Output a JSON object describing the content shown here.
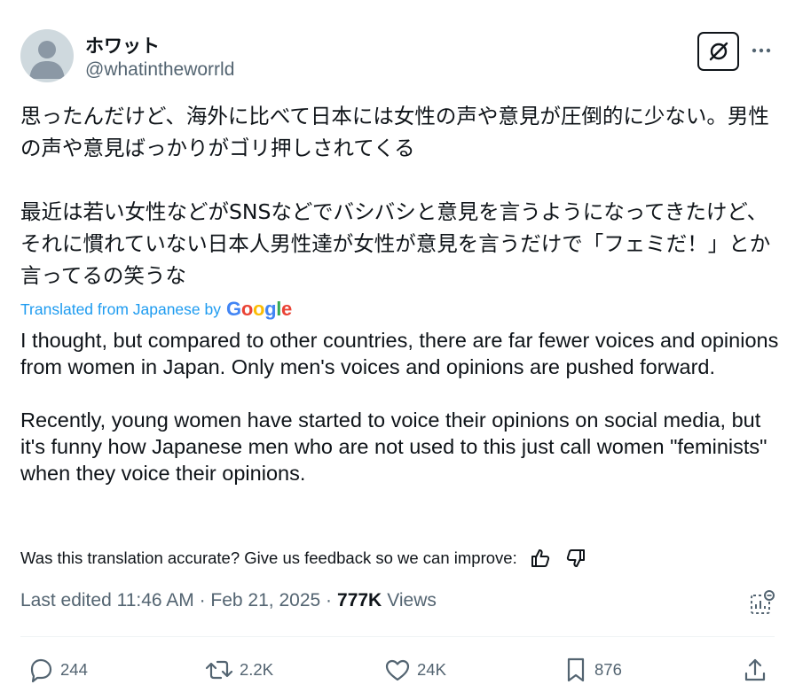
{
  "author": {
    "display_name": "ホワット",
    "handle": "@whatintheworrld"
  },
  "post": {
    "text_jp": "思ったんだけど、海外に比べて日本には女性の声や意見が圧倒的に少ない。男性の声や意見ばっかりがゴリ押しされてくる\n\n最近は若い女性などがSNSなどでバシバシと意見を言うようになってきたけど、それに慣れていない日本人男性達が女性が意見を言うだけで「フェミだ！」とか言ってるの笑うな",
    "translated_label": "Translated from Japanese by",
    "google_logo": {
      "g1": "G",
      "o1": "o",
      "o2": "o",
      "g2": "g",
      "l": "l",
      "e": "e"
    },
    "text_en": "I thought, but compared to other countries, there are far fewer voices and opinions from women in Japan. Only men's voices and opinions are pushed forward.\n\nRecently, young women have started to voice their opinions on social media, but it's funny how Japanese men who are not used to this just call women \"feminists\" when they voice their opinions.",
    "feedback_prompt": "Was this translation accurate? Give us feedback so we can improve:",
    "meta": {
      "edited": "Last edited 11:46 AM · Feb 21, 2025 ·",
      "views_count": "777K",
      "views_label": "Views"
    }
  },
  "actions": {
    "replies": "244",
    "reposts": "2.2K",
    "likes": "24K",
    "bookmarks": "876"
  },
  "icons": [
    "grok-icon",
    "more-icon",
    "thumbs-up-icon",
    "thumbs-down-icon",
    "analytics-icon",
    "reply-icon",
    "repost-icon",
    "like-icon",
    "bookmark-icon",
    "share-icon"
  ],
  "colors": {
    "text": "#0f1419",
    "secondary": "#536471",
    "link": "#1d9bf0",
    "avatar": "#cfd9de"
  }
}
